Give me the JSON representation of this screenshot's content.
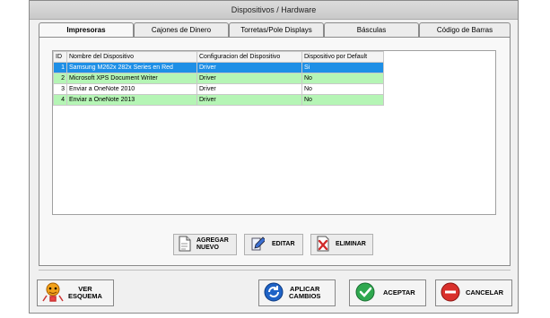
{
  "window": {
    "title": "Dispositivos / Hardware"
  },
  "tabs": [
    {
      "label": "Impresoras"
    },
    {
      "label": "Cajones de Dinero"
    },
    {
      "label": "Torretas/Pole Displays"
    },
    {
      "label": "Básculas"
    },
    {
      "label": "Código de Barras"
    }
  ],
  "table": {
    "columns": [
      "ID",
      "Nombre del Dispositivo",
      "Configuracion del Dispositivo",
      "Dispositivo por Default"
    ],
    "rows": [
      {
        "id": "1",
        "name": "Samsung M262x 282x Series en Red",
        "config": "Driver",
        "default": "Si",
        "style": "selected"
      },
      {
        "id": "2",
        "name": "Microsoft XPS Document Writer",
        "config": "Driver",
        "default": "No",
        "style": "green"
      },
      {
        "id": "3",
        "name": "Enviar a OneNote 2010",
        "config": "Driver",
        "default": "No",
        "style": "white"
      },
      {
        "id": "4",
        "name": "Enviar a OneNote 2013",
        "config": "Driver",
        "default": "No",
        "style": "green"
      }
    ]
  },
  "actions": {
    "agregar_line1": "AGREGAR",
    "agregar_line2": "NUEVO",
    "editar": "EDITAR",
    "eliminar": "ELIMINAR"
  },
  "footer": {
    "ver_line1": "VER",
    "ver_line2": "ESQUEMA",
    "aplicar_line1": "APLICAR",
    "aplicar_line2": "CAMBIOS",
    "aceptar": "ACEPTAR",
    "cancelar": "CANCELAR"
  },
  "colors": {
    "selected_row": "#1e8fe6",
    "green_row": "#b5f5b5",
    "accept_green": "#2fa84f",
    "cancel_red": "#d9302c",
    "apply_blue": "#1f63c6"
  },
  "icons": {
    "agregar": "document-add-icon",
    "editar": "edit-pencil-icon",
    "eliminar": "delete-x-icon",
    "ver": "cartoon-person-icon",
    "aplicar": "refresh-circle-icon",
    "aceptar": "check-circle-icon",
    "cancelar": "minus-circle-icon"
  }
}
